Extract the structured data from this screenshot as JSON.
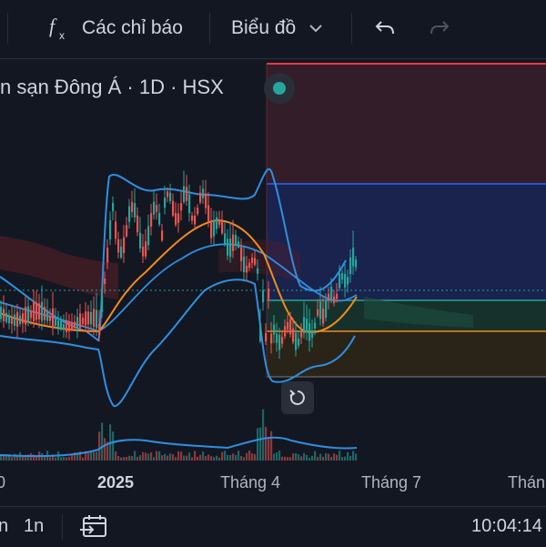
{
  "toolbar": {
    "indicators_label": "Các chỉ báo",
    "chart_type_label": "Biểu đồ",
    "icons": [
      "function-icon",
      "chevron-down-icon",
      "undo-icon",
      "redo-icon"
    ]
  },
  "legend": {
    "symbol_text": "n sạn Đông Á · 1D · HSX",
    "status_color": "#26a69a"
  },
  "time_axis": {
    "ticks": [
      "0",
      "2025",
      "Tháng 4",
      "Tháng 7",
      "Thán"
    ]
  },
  "bottom_bar": {
    "interval_a": "n",
    "interval_b": "1n",
    "clock": "10:04:14"
  },
  "colors": {
    "background": "#131722",
    "up": "#26a69a",
    "down": "#ef5350",
    "band": "#2f8fe0",
    "ma": "#f08c1e"
  }
}
